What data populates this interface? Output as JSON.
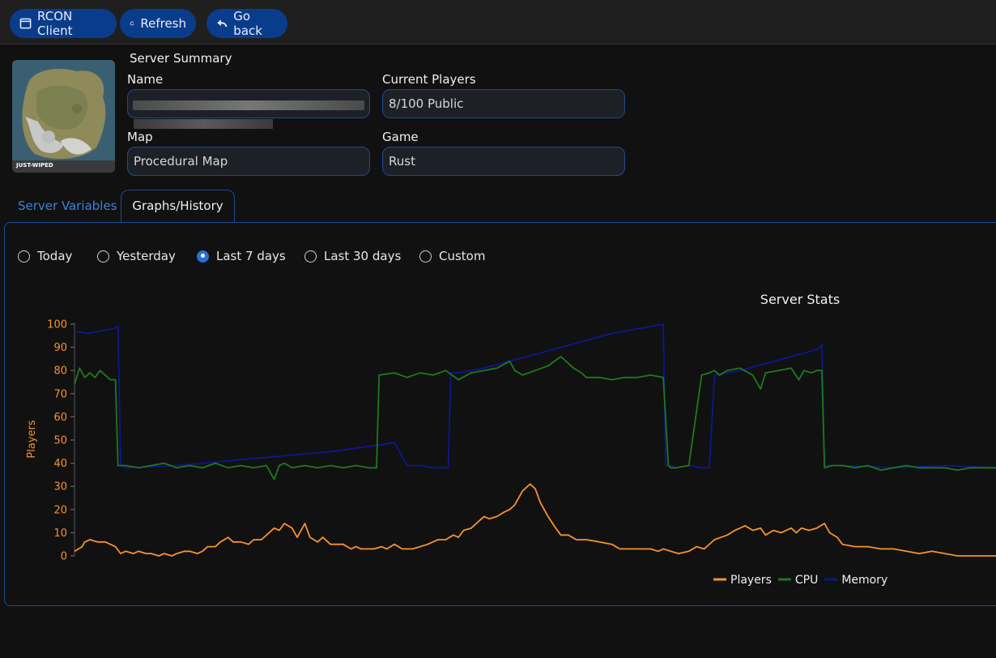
{
  "toolbar": {
    "rcon_label": "RCON Client",
    "refresh_label": "Refresh",
    "back_label": "Go back"
  },
  "summary": {
    "heading": "Server Summary",
    "name_label": "Name",
    "players_label": "Current Players",
    "players_value": "8/100 Public",
    "map_label": "Map",
    "map_value": "Procedural Map",
    "game_label": "Game",
    "game_value": "Rust",
    "map_badge": "JUST-WIPED"
  },
  "tabs": [
    {
      "label": "Server Variables",
      "active": false
    },
    {
      "label": "Graphs/History",
      "active": true
    }
  ],
  "ranges": [
    {
      "label": "Today",
      "checked": false
    },
    {
      "label": "Yesterday",
      "checked": false
    },
    {
      "label": "Last 7 days",
      "checked": true
    },
    {
      "label": "Last 30 days",
      "checked": false
    },
    {
      "label": "Custom",
      "checked": false
    }
  ],
  "colors": {
    "players": "#f7922f",
    "cpu": "#1e7a1e",
    "memory": "#0f1690",
    "accent": "#0a3c8c"
  },
  "chart_data": {
    "type": "line",
    "title": "Server Stats",
    "ylabel": "Players",
    "ylim": [
      0,
      100
    ],
    "yticks": [
      "0",
      "10",
      "20",
      "30",
      "40",
      "50",
      "60",
      "70",
      "80",
      "90",
      "100"
    ],
    "legend": "bottom-right",
    "series": [
      {
        "name": "Players",
        "color": "#f7922f",
        "x": [
          0,
          3,
          4,
          6,
          9,
          12,
          14,
          16,
          18,
          20,
          23,
          25,
          28,
          30,
          33,
          35,
          38,
          40,
          43,
          45,
          48,
          50,
          52,
          55,
          57,
          60,
          62,
          65,
          68,
          70,
          73,
          75,
          78,
          80,
          82,
          85,
          87,
          90,
          92,
          95,
          97,
          100,
          105,
          108,
          110,
          112,
          115,
          117,
          120,
          122,
          125,
          128,
          132,
          135,
          138,
          140,
          142,
          145,
          148,
          150,
          152,
          155,
          158,
          160,
          162,
          165,
          168,
          170,
          172,
          175,
          178,
          180,
          182,
          185,
          188,
          190,
          193,
          196,
          200,
          205,
          210,
          213,
          215,
          220,
          225,
          228,
          230,
          233,
          236,
          240,
          243,
          246,
          250,
          255,
          258,
          260,
          262,
          265,
          268,
          270,
          273,
          276,
          280,
          282,
          284,
          287,
          290,
          293,
          295,
          298,
          300,
          305,
          310,
          315,
          320,
          325,
          330,
          335,
          340,
          345,
          350,
          355,
          360
        ],
        "y": [
          2,
          4,
          6,
          7,
          6,
          6,
          5,
          4,
          1,
          2,
          1,
          2,
          1,
          1,
          0,
          1,
          0,
          1,
          2,
          2,
          1,
          2,
          4,
          4,
          6,
          8,
          6,
          6,
          5,
          7,
          7,
          9,
          12,
          11,
          14,
          12,
          8,
          14,
          8,
          6,
          8,
          5,
          5,
          3,
          4,
          3,
          3,
          3,
          4,
          3,
          5,
          3,
          3,
          4,
          5,
          6,
          7,
          7,
          9,
          8,
          11,
          12,
          15,
          17,
          16,
          17,
          19,
          20,
          22,
          28,
          31,
          29,
          23,
          17,
          12,
          9,
          9,
          7,
          7,
          6,
          5,
          3,
          3,
          3,
          3,
          2,
          3,
          2,
          1,
          2,
          4,
          3,
          7,
          9,
          11,
          12,
          13,
          11,
          12,
          9,
          11,
          10,
          12,
          10,
          12,
          11,
          12,
          14,
          10,
          8,
          5,
          4,
          4,
          3,
          3,
          2,
          1,
          2,
          1,
          0,
          0,
          0,
          0
        ]
      },
      {
        "name": "CPU",
        "color": "#1e7a1e",
        "x": [
          0,
          2,
          4,
          6,
          8,
          10,
          12,
          14,
          16,
          17,
          18,
          20,
          25,
          30,
          35,
          40,
          45,
          50,
          55,
          60,
          65,
          70,
          75,
          78,
          80,
          82,
          85,
          90,
          95,
          100,
          105,
          110,
          115,
          118,
          119,
          125,
          130,
          135,
          140,
          145,
          150,
          155,
          160,
          165,
          170,
          172,
          175,
          180,
          185,
          190,
          195,
          198,
          200,
          205,
          210,
          215,
          220,
          225,
          230,
          232,
          233,
          235,
          240,
          245,
          248,
          250,
          252,
          255,
          260,
          265,
          268,
          270,
          275,
          280,
          283,
          285,
          288,
          290,
          292,
          293,
          296,
          300,
          305,
          310,
          315,
          320,
          325,
          330,
          335,
          340,
          345,
          350,
          355,
          360
        ],
        "y": [
          74,
          81,
          77,
          79,
          77,
          80,
          78,
          76,
          76,
          39,
          39,
          39,
          38,
          39,
          40,
          38,
          39,
          38,
          40,
          38,
          39,
          38,
          39,
          33,
          39,
          40,
          38,
          39,
          38,
          39,
          38,
          39,
          38,
          38,
          78,
          79,
          77,
          79,
          78,
          80,
          76,
          79,
          80,
          81,
          84,
          80,
          78,
          80,
          82,
          86,
          81,
          79,
          77,
          77,
          76,
          77,
          77,
          78,
          77,
          39,
          38,
          38,
          39,
          78,
          79,
          80,
          78,
          80,
          81,
          78,
          72,
          79,
          80,
          81,
          76,
          80,
          79,
          80,
          80,
          38,
          39,
          39,
          38,
          39,
          37,
          38,
          39,
          38,
          38,
          38,
          37,
          38,
          38,
          38
        ]
      },
      {
        "name": "Memory",
        "color": "#0f1690",
        "x": [
          0,
          5,
          10,
          15,
          17,
          18,
          20,
          40,
          60,
          80,
          100,
          120,
          125,
          130,
          135,
          140,
          145,
          146,
          147,
          150,
          160,
          170,
          180,
          190,
          200,
          210,
          220,
          230,
          231,
          233,
          235,
          240,
          245,
          248,
          250,
          260,
          270,
          280,
          290,
          292,
          293,
          300,
          320,
          340,
          360
        ],
        "y": [
          97,
          96,
          97,
          98,
          99,
          39,
          38,
          39,
          41,
          43,
          45,
          48,
          49,
          39,
          39,
          38,
          38,
          38,
          79,
          79,
          81,
          84,
          87,
          90,
          93,
          96,
          98,
          100,
          39,
          39,
          38,
          39,
          38,
          38,
          78,
          80,
          83,
          86,
          89,
          91,
          39,
          39,
          38,
          39,
          38
        ]
      }
    ]
  }
}
